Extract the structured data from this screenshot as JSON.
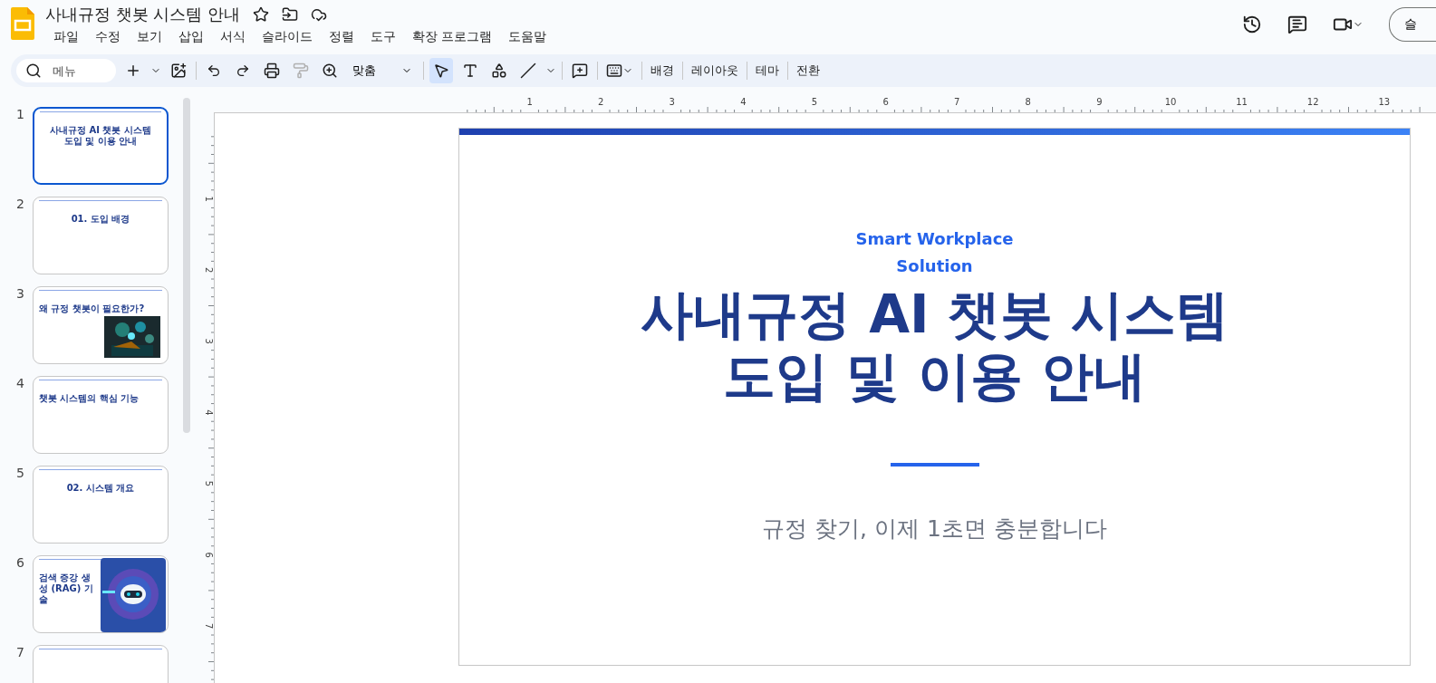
{
  "document": {
    "title": "사내규정 챗봇 시스템 안내"
  },
  "menu": [
    "파일",
    "수정",
    "보기",
    "삽입",
    "서식",
    "슬라이드",
    "정렬",
    "도구",
    "확장 프로그램",
    "도움말"
  ],
  "header_button": {
    "label": "슬"
  },
  "toolbar": {
    "search": {
      "placeholder": "메뉴"
    },
    "zoom": "맞춤",
    "tools": [
      {
        "kind": "select",
        "selected": true
      },
      {
        "kind": "text",
        "selected": false
      },
      {
        "kind": "shape",
        "selected": false
      },
      {
        "kind": "line",
        "selected": false
      }
    ],
    "paint_format_disabled": true,
    "text_buttons": [
      "배경",
      "레이아웃",
      "테마",
      "전환"
    ]
  },
  "ruler": {
    "horizontal": [
      "1",
      "2",
      "3",
      "4",
      "5",
      "6",
      "7",
      "8",
      "9",
      "10",
      "11",
      "12",
      "13"
    ],
    "vertical": [
      "1",
      "2",
      "3",
      "4",
      "5",
      "6",
      "7"
    ]
  },
  "slides": [
    {
      "number": "1",
      "selected": true,
      "kind": "title",
      "title": "사내규정 AI 챗봇 시스템\n도입 및 이용 안내"
    },
    {
      "number": "2",
      "selected": false,
      "kind": "section",
      "title": "01. 도입 배경"
    },
    {
      "number": "3",
      "selected": false,
      "title": "왜 규정 챗봇이 필요한가?"
    },
    {
      "number": "4",
      "selected": false,
      "kind": "cards",
      "title": "챗봇 시스템의 핵심 기능"
    },
    {
      "number": "5",
      "selected": false,
      "kind": "section",
      "title": "02. 시스템 개요"
    },
    {
      "number": "6",
      "selected": false,
      "kind": "robot",
      "title": "검색 증강 생성 (RAG) 기술"
    },
    {
      "number": "7",
      "selected": false,
      "kind": "partial"
    }
  ],
  "current_slide": {
    "kicker": "Smart Workplace\nSolution",
    "title_lines": [
      "사내규정 AI 챗봇 시스템",
      "도입 및 이용 안내"
    ],
    "subtitle": "규정 찾기, 이제 1초면 충분합니다"
  }
}
